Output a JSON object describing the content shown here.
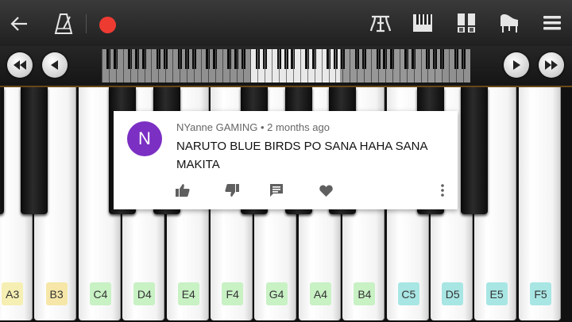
{
  "toolbar": {
    "icons": [
      "back-arrow-icon",
      "metronome-icon",
      "record-icon",
      "chord-icon",
      "keyboard-icon",
      "dual-keyboard-icon",
      "grand-piano-icon",
      "menu-icon"
    ],
    "record_color": "#ee3b32"
  },
  "navigation": {
    "icons": [
      "fast-rewind-icon",
      "previous-icon",
      "next-icon",
      "fast-forward-icon"
    ]
  },
  "piano": {
    "white_keys": [
      {
        "label": "A3",
        "color": "#f6efb3"
      },
      {
        "label": "B3",
        "color": "#f6e7a8"
      },
      {
        "label": "C4",
        "color": "#c8f1c4"
      },
      {
        "label": "D4",
        "color": "#c8f1c4"
      },
      {
        "label": "E4",
        "color": "#c8f1c4"
      },
      {
        "label": "F4",
        "color": "#c8f1c4"
      },
      {
        "label": "G4",
        "color": "#c8f1c4"
      },
      {
        "label": "A4",
        "color": "#c8f1c4"
      },
      {
        "label": "B4",
        "color": "#c8f1c4"
      },
      {
        "label": "C5",
        "color": "#a8e6e4"
      },
      {
        "label": "D5",
        "color": "#a8e6e4"
      },
      {
        "label": "E5",
        "color": "#a8e6e4"
      },
      {
        "label": "F5",
        "color": "#a8e6e4"
      }
    ]
  },
  "comment": {
    "avatar_letter": "N",
    "avatar_color": "#7b2fc3",
    "author": "NYanne GAMING",
    "separator": "•",
    "time": "2 months ago",
    "text": "NARUTO BLUE BIRDS PO SANA HAHA SANA MAKITA",
    "actions": [
      "thumbs-up-icon",
      "thumbs-down-icon",
      "reply-icon",
      "heart-icon",
      "more-vert-icon"
    ]
  }
}
